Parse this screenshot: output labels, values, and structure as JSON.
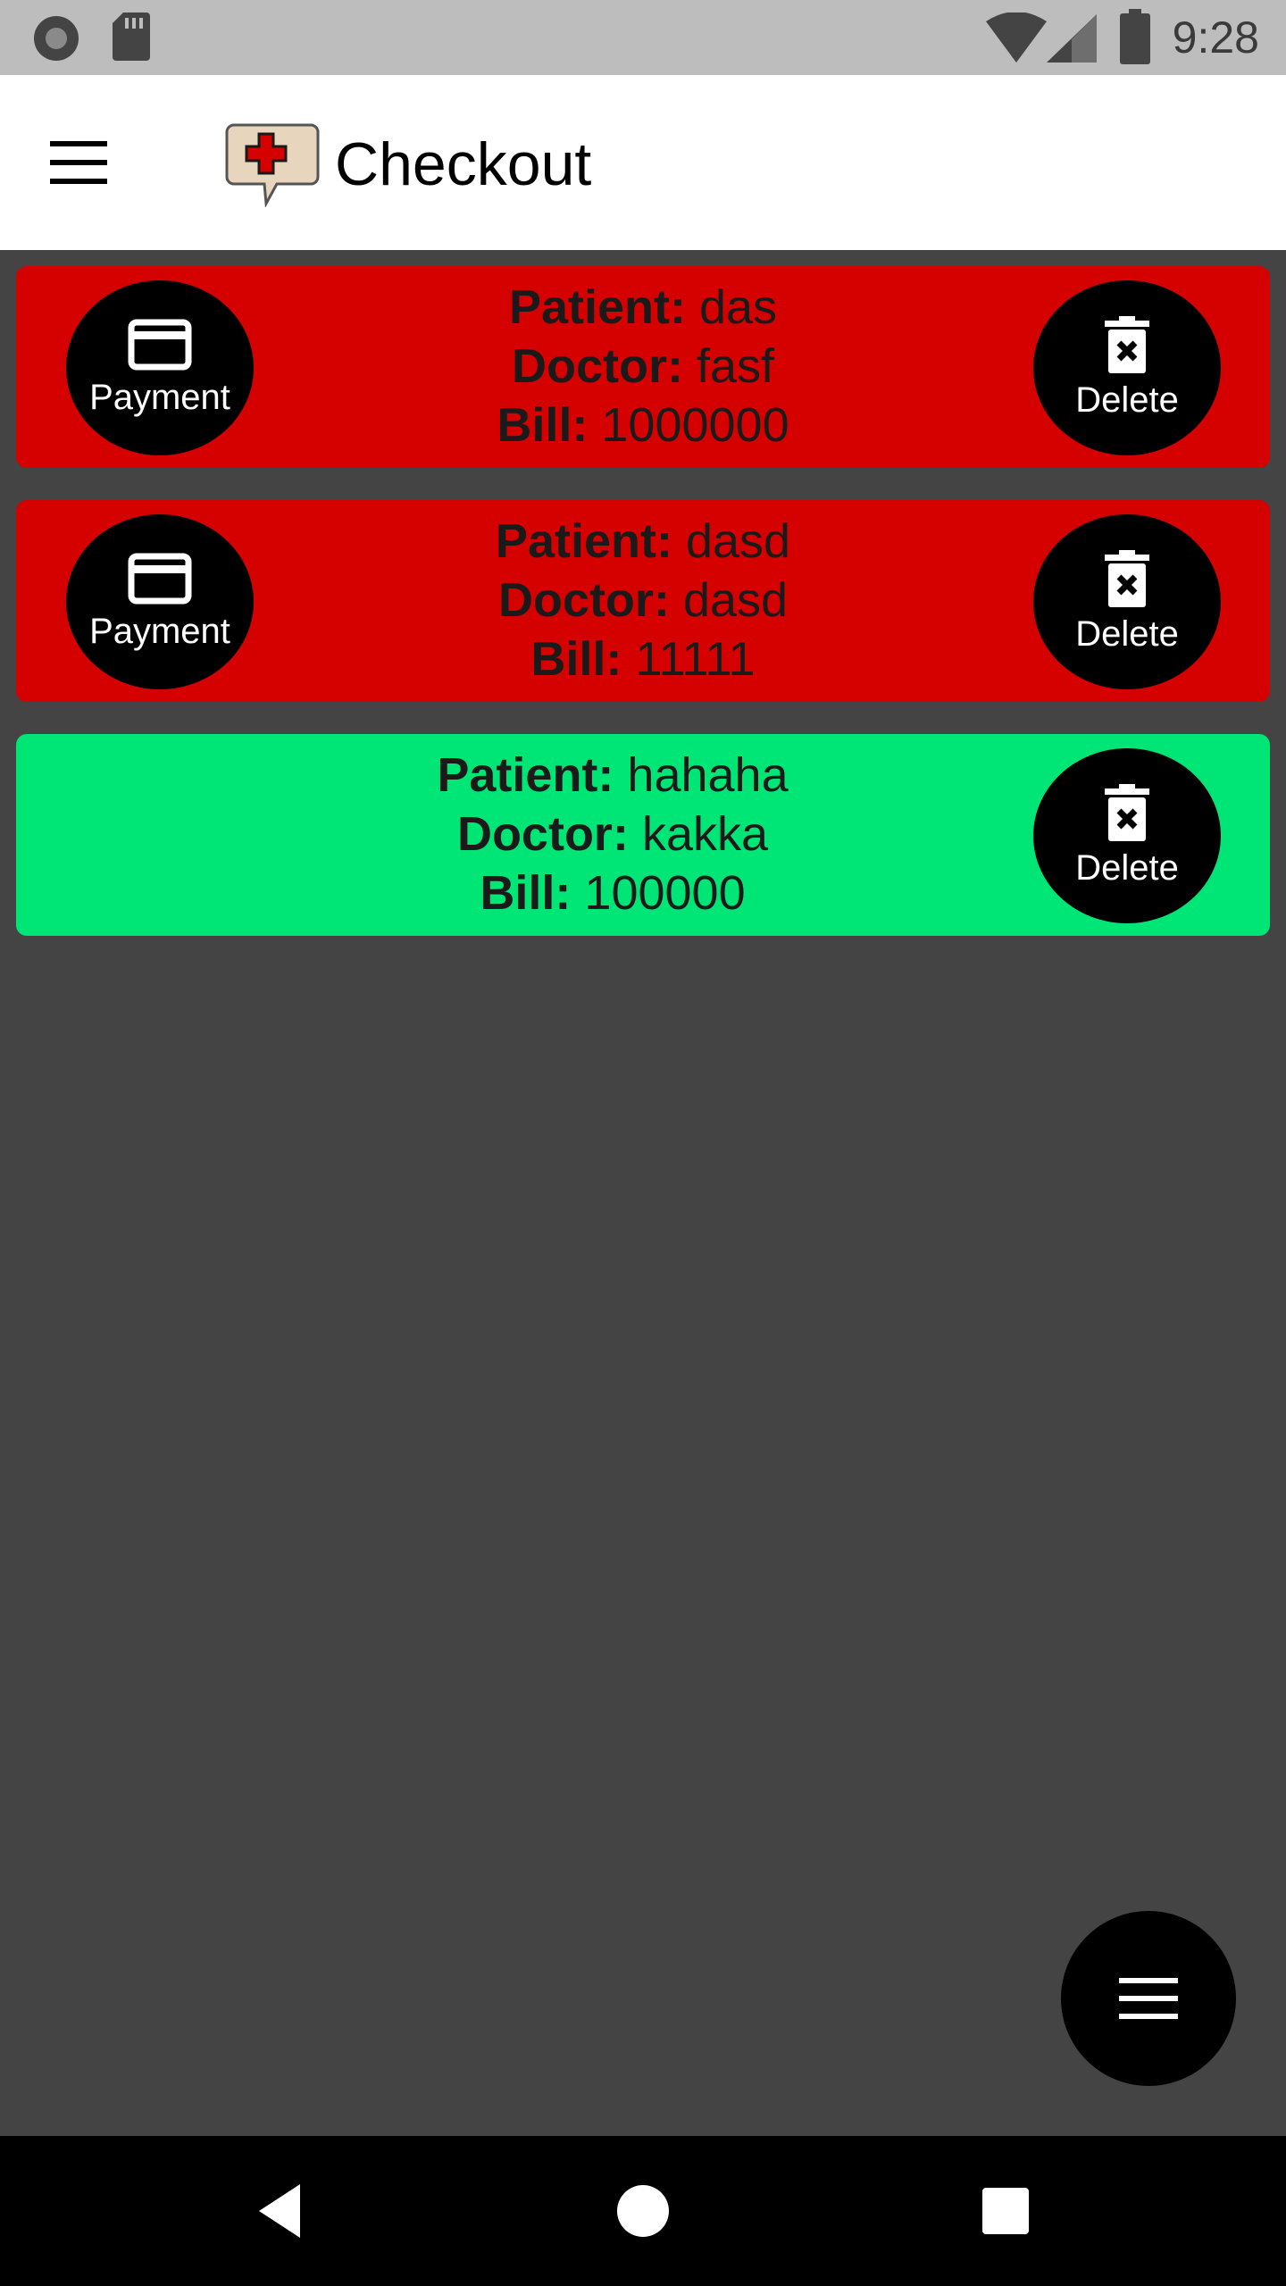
{
  "status_bar": {
    "time": "9:28",
    "icons": [
      "record-icon",
      "sd-card-icon",
      "wifi-icon",
      "signal-icon",
      "battery-icon"
    ]
  },
  "app_bar": {
    "title": "Checkout",
    "menu_icon": "hamburger-menu-icon",
    "logo": "medical-chat-logo"
  },
  "checkout_items": [
    {
      "patient_label": "Patient:",
      "patient": "das",
      "doctor_label": "Doctor:",
      "doctor": "fasf",
      "bill_label": "Bill:",
      "bill": "1000000",
      "status_color": "#d50000",
      "payment_label": "Payment",
      "delete_label": "Delete"
    },
    {
      "patient_label": "Patient:",
      "patient": "dasd",
      "doctor_label": "Doctor:",
      "doctor": "dasd",
      "bill_label": "Bill:",
      "bill": "11111",
      "status_color": "#d50000",
      "payment_label": "Payment",
      "delete_label": "Delete"
    },
    {
      "patient_label": "Patient:",
      "patient": "hahaha",
      "doctor_label": "Doctor:",
      "doctor": "kakka",
      "bill_label": "Bill:",
      "bill": "100000",
      "status_color": "#00e676",
      "delete_label": "Delete"
    }
  ],
  "fab": {
    "icon": "menu-lines-icon"
  },
  "nav_bar": {
    "icons": [
      "back-icon",
      "home-icon",
      "recents-icon"
    ]
  },
  "colors": {
    "background": "#444444",
    "unpaid": "#d50000",
    "paid": "#00e676",
    "button": "#000000"
  }
}
